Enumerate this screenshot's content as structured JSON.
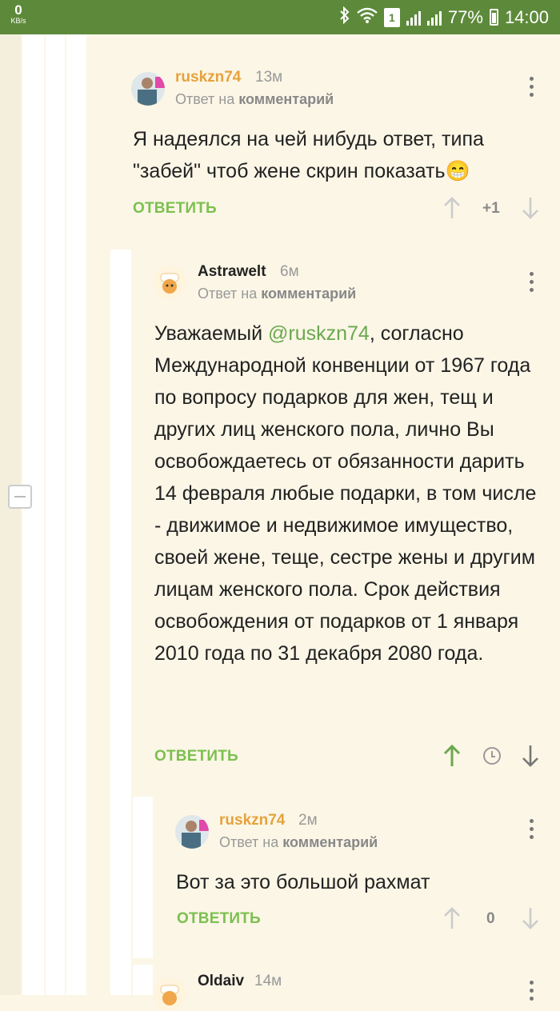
{
  "status_bar": {
    "net_speed_value": "0",
    "net_speed_unit": "KB/s",
    "sim_badge": "1",
    "battery_percent": "77%",
    "time": "14:00",
    "icons": [
      "bluetooth-icon",
      "wifi-icon",
      "sim-icon",
      "signal-icon",
      "battery-icon"
    ]
  },
  "colors": {
    "status_bar": "#5d8a3a",
    "background": "#fbf6e6",
    "username": "#e6a23c",
    "reply_button": "#7cc04f",
    "upvote_active": "#6aa84f"
  },
  "comments": [
    {
      "username": "ruskzn74",
      "time": "13м",
      "reply_prefix": "Ответ на ",
      "reply_target": "комментарий",
      "body_line1": "Я надеялся на чей нибудь ответ, типа",
      "body_line2": "\"забей\" чтоб жене скрин показать😁",
      "reply_label": "ОТВЕТИТЬ",
      "score": "+1"
    },
    {
      "username": "Astrawelt",
      "time": "6м",
      "reply_prefix": "Ответ на ",
      "reply_target": "комментарий",
      "body_before_mention": "Уважаемый ",
      "mention": "@ruskzn74",
      "body_after_mention": ", согласно Международной конвенции от 1967 года по вопросу подарков для жен, тещ и других лиц женского пола, лично Вы освобождаетесь от обязанности дарить 14 февраля любые подарки, в том числе - движимое и недвижимое имущество, своей жене, теще, сестре жены и другим лицам женского пола. Срок действия освобождения от подарков от 1 января 2010 года по 31 декабря 2080 года.",
      "reply_label": "ОТВЕТИТЬ"
    },
    {
      "username": "ruskzn74",
      "time": "2м",
      "reply_prefix": "Ответ на ",
      "reply_target": "комментарий",
      "body": "Вот за это большой рахмат",
      "reply_label": "ОТВЕТИТЬ",
      "score": "0"
    },
    {
      "username": "Oldaiv",
      "time": "14м"
    }
  ]
}
